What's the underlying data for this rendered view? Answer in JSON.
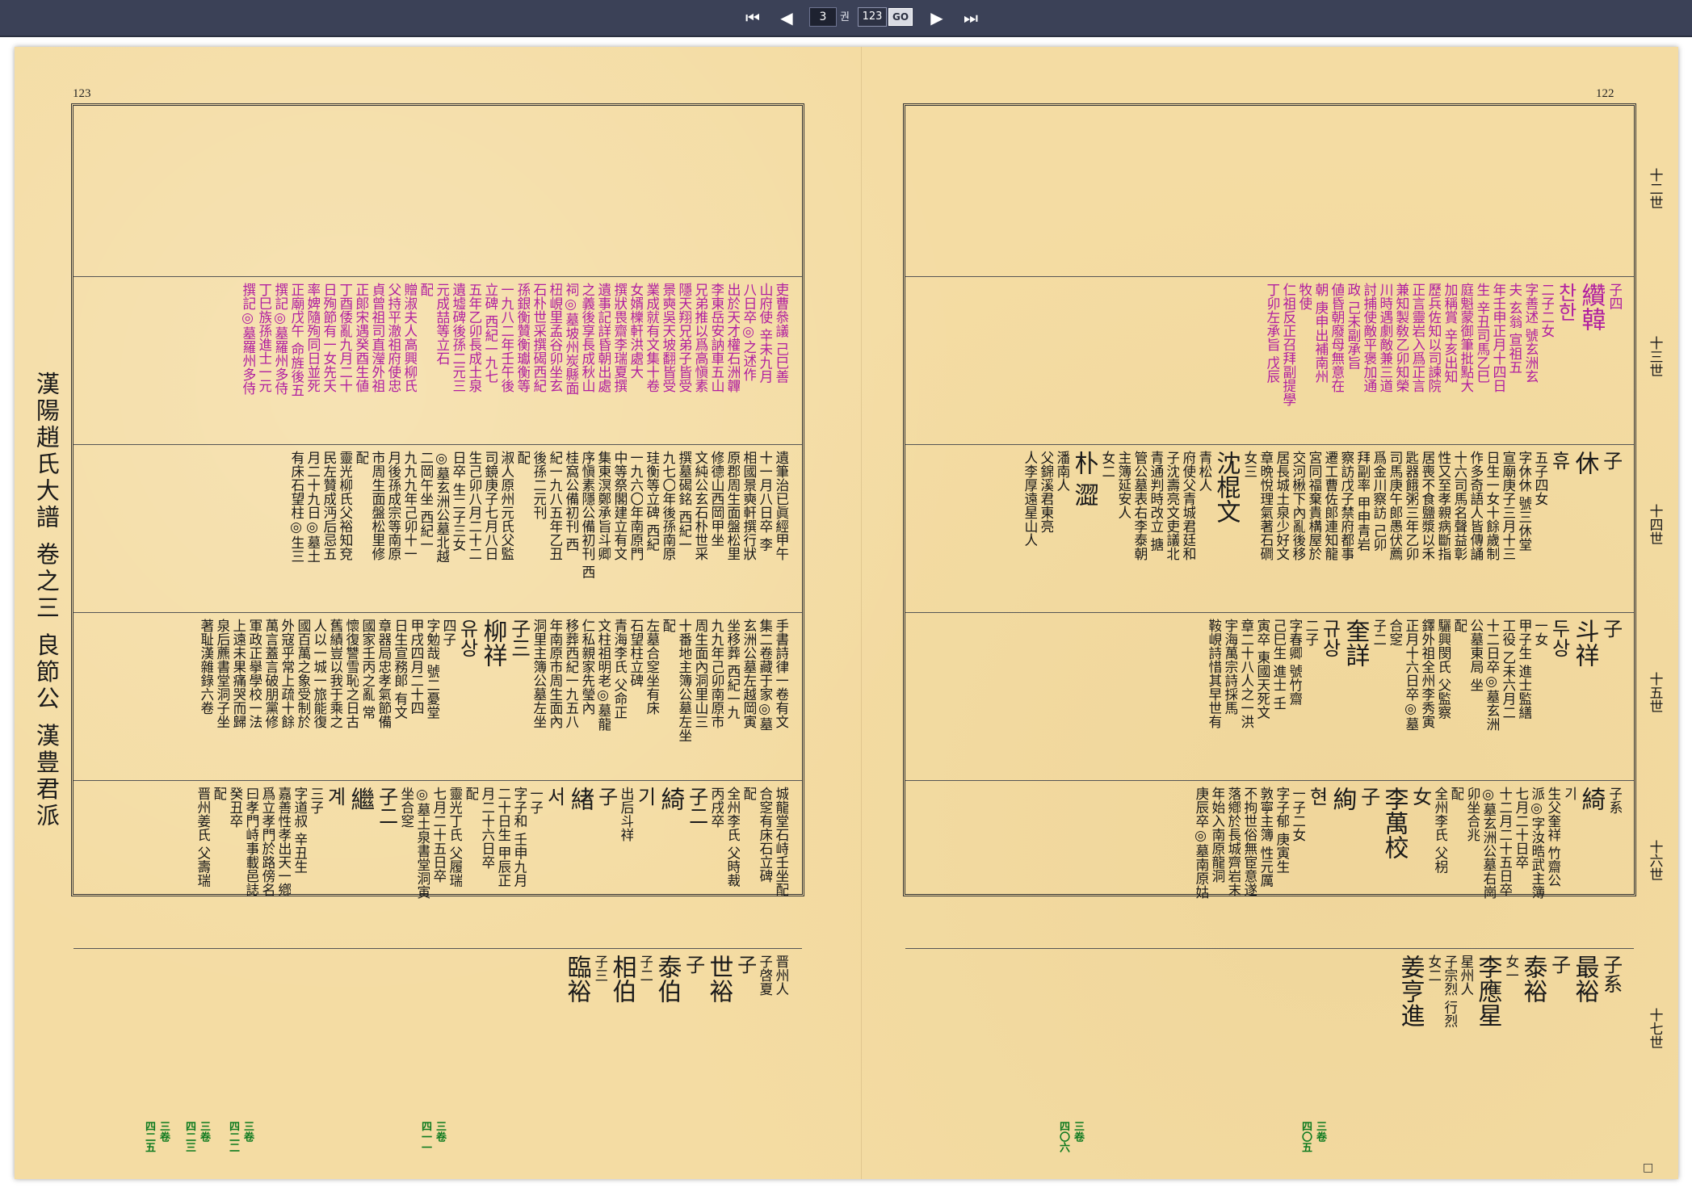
{
  "nav": {
    "first": "⏮",
    "prev": "◀",
    "page_value": "3",
    "unit": "권",
    "total": "123",
    "go": "GO",
    "next": "▶",
    "last": "⏭"
  },
  "book": {
    "title": "漢陽趙氏大譜 卷之三 良節公 漢豊君派",
    "left_page_number": "123",
    "right_page_number": "122",
    "corner_mark": "□",
    "generations": [
      "十二世",
      "十三世",
      "十四世",
      "十五世",
      "十六世",
      "十七世"
    ]
  },
  "right_page": {
    "r2_mag": [
      "子四",
      "纘韓",
      "찬한",
      "二子二女",
      "字善述 號玄洲玄",
      "夫 玄翁 宣祖五",
      "年壬申正月十四日",
      "生 辛丑司馬乙巳",
      "庭魁蒙御筆批點大",
      "加稱賞 辛亥出知",
      "歷兵佐知以司諫院",
      "正言靈岩入爲正言",
      "兼知製敎乙卯知榮",
      "川時遇劇敵兼三道",
      "討捕使敵平褒加通",
      "政 己未副承旨",
      "値昏朝廢母無意在",
      "朝 庚申出補南州",
      "牧使",
      "仁祖反正召拜副提學",
      "丁卯左承旨 戊辰"
    ],
    "r3": [
      "子",
      "休",
      "휴",
      "五子四女",
      "字休休 號三休堂",
      "宣廟庚子三月十三",
      "日生一女十餘歲制",
      "作多奇語人皆傳誦",
      "十六司馬名聲益彰",
      "性又至孝親病斷指",
      "居喪不食鹽漿以禾",
      "匙器餓粥三年乙卯",
      "司馬庚午郞愚伏薦",
      "爲金川察訪 己卯",
      "拜副率 甲申青岩",
      "察訪戊子禁府都事",
      "遷工曹佐郞連知龍",
      "宮同福棄貴構屋於",
      "交河楸下內亂後移",
      "居長城土泉少好文",
      "章晩悅理氣著石磵",
      "女三",
      "沈棍文",
      "青松人",
      "府使父青城君廷和",
      "子沈壽亮文吏議北",
      "青通判時改立 搪",
      "管公墓表右李泰朝",
      "主簿延安人",
      "女二",
      "朴 澀",
      "潘南人",
      "父錦溪君東亮",
      "人李厚遠星山人"
    ],
    "r4": [
      "子",
      "斗祥",
      "두상",
      "一女",
      "甲子生 進士監繕",
      "工役 乙未六月二",
      "十二日卒◎墓玄洲",
      "公墓東局 坐",
      "配",
      "驪興閔氏 父監察",
      "鐸外祖全州李秀寅",
      "正月十六日卒◎墓",
      "合窆",
      "子二",
      "奎詳",
      "규상",
      "二子",
      "字春卿 號竹齋",
      "己巳生 進士 壬",
      "寅卒 東國天死文",
      "章二十八人之一洪",
      "宇海萬宗詩採馬",
      "鞍峴詩惜其早世有"
    ],
    "r5": [
      "子系",
      "綺",
      "기",
      "生父奎祥 竹齋公",
      "派◎字汝晧武主簿",
      "七月二十日卒",
      "十二月二十五日卒",
      "◎墓玄洲公墓右崗",
      "卯坐合兆",
      "配",
      "全州李氏 父枴",
      "女",
      "李萬校",
      "子",
      "絢",
      "현",
      "一子二女",
      "字子郁 庚寅生",
      "敦寧主簿 性元厲",
      "不拘世俗無宦意遂",
      "落鄕於長城齊岩末",
      "年始入南原龍洞",
      "庚辰卒◎墓南原姑"
    ],
    "r6": [
      "子系",
      "最裕",
      "子",
      "泰裕",
      "女一",
      "李應星",
      "星州人",
      "子宗烈 行烈",
      "女二",
      "姜亨進"
    ],
    "r6_green": [
      "四〇五",
      "三卷",
      "四〇六",
      "三卷"
    ]
  },
  "left_page": {
    "l2_mag": [
      "吏曹叅議 己巳善",
      "山府使 辛未九月",
      "八日卒◎之述作",
      "出於天才權石洲韠",
      "李東岳安訥車五山",
      "兄弟推以爲高愼素",
      "隱天翔兄弟子皆受",
      "景奭吳天坡翻皆受",
      "業成就有文集十卷",
      "女婿櫟軒洪處大",
      "撰狀畏齋李瑞夏撰",
      "遺事記詳昏朝出處",
      "之義後享長成秋山",
      "祠◎墓坡州炭縣面",
      "杻峴里孟谷卯坐玄",
      "石朴世采撰碣西紀",
      "孫銀衡贊衡瓛衡等",
      "一九八二年壬午後",
      "立碑 西紀一九七",
      "五年乙卯長成土泉",
      "遺墟碑後孫二元三",
      "元成喆等立石",
      "配",
      "贈淑夫人高興柳氏",
      "父持平澈祖府使忠",
      "貞曾祖司直瀅外祖",
      "正郞宋遇癸酉生値",
      "丁酉倭亂九月二十",
      "日殉節有一女先夭",
      "率婢隨殉同日並死",
      "正廟戊午 命旌後五",
      "撰記◎墓羅州多侍",
      "丁巳族孫進士一元",
      "撰記◎墓羅州多侍"
    ],
    "l3": [
      "遺筆治已眞經甲午",
      "十一月八日卒 李",
      "相國景奭軒撰行狀",
      "原郡周生面盤松里",
      "修德山西岡甲坐",
      "文純公玄石朴世采",
      "撰墓碣銘 西紀一",
      "九七〇年後孫南原",
      "珪衡等立碑 西紀",
      "一九六〇年南原門",
      "中等祭閣建立有文",
      "集東溟鄭承旨斗卿",
      "序愼素隱公備初刊 西",
      "桂窩公備初刊 西",
      "紀一九八五年乙丑",
      "後孫二元刊",
      "配",
      "淑人原州元氏父監",
      "司鏡庚子七月八日",
      "生己卯八月二十二",
      "日卒 生二子三女",
      "◎墓玄洲公墓北越",
      "二岡午坐 西紀一",
      "九九九年己卯十一",
      "月後孫成宗等南原",
      "市周生面盤松里修",
      "配",
      "靈光柳氏父裕知兗",
      "民左贊成沔后忌五",
      "月二十九日◎墓土",
      "有床石望柱◎生三"
    ],
    "l4": [
      "手書詩律一卷有文",
      "集二卷藏于家◎墓",
      "玄洲公墓左越岡寅",
      "坐移葬 西紀一九",
      "九九年己卯南原市",
      "周生面內洞里山三",
      "十番地主簿公墓左坐",
      "配",
      "左墓合窆坐有床",
      "石望柱立碑",
      "青海李氏 父命正",
      "文柱祖明老◎墓龍",
      "仁私親家先瑩內",
      "移葬西紀一九五八",
      "年南原市周生面內",
      "洞里主簿公墓左坐",
      "子三",
      "柳祥",
      "유상",
      "四子",
      "字勉哉 號二憂堂",
      "甲戌四月二十四",
      "日生宣務郞 有文",
      "章器局忠孝氣節備",
      "國家壬丙之亂 常",
      "懷復讐雪恥之日古",
      "舊績豈以我于乘之",
      "人以一城一旅能復",
      "國百萬之象受制於",
      "外寇乎常上疏十餘",
      "萬言蓋言破朋黨修",
      "軍政正擧學校一法",
      "上遠未果痛哭而歸",
      "泉后藨書堂洞子坐",
      "著耻漢雜錄六卷"
    ],
    "l5": [
      "城龍堂石峙壬坐配",
      "合窆有床石立碑",
      "配",
      "全州李氏 父時裁",
      "丙戌卒",
      "子二",
      "綺",
      "기",
      "出后斗祥",
      "子",
      "緖",
      "서",
      "一子",
      "字子和 壬申九月",
      "二十日生 甲辰正",
      "月二十六日卒",
      "配",
      "靈光丁氏 父履瑞",
      "七月二十五日卒",
      "◎墓土泉書堂洞寅",
      "坐合窆",
      "子二",
      "繼",
      "계",
      "三子",
      "字道叔 辛丑生",
      "嘉善性孝出天一鄕",
      "爲立孝門於路傍名",
      "曰孝門峙事載邑誌",
      "癸丑卒",
      "配",
      "晋州姜氏 父壽瑞"
    ],
    "l6": [
      "晋州人",
      "子啓夏",
      "子",
      "世裕",
      "子",
      "泰伯",
      "子二",
      "相伯",
      "子三",
      "臨裕"
    ],
    "l6_green": [
      "四一一",
      "三卷",
      "四二二",
      "三卷",
      "四二三",
      "三卷",
      "四二五",
      "三卷"
    ]
  }
}
